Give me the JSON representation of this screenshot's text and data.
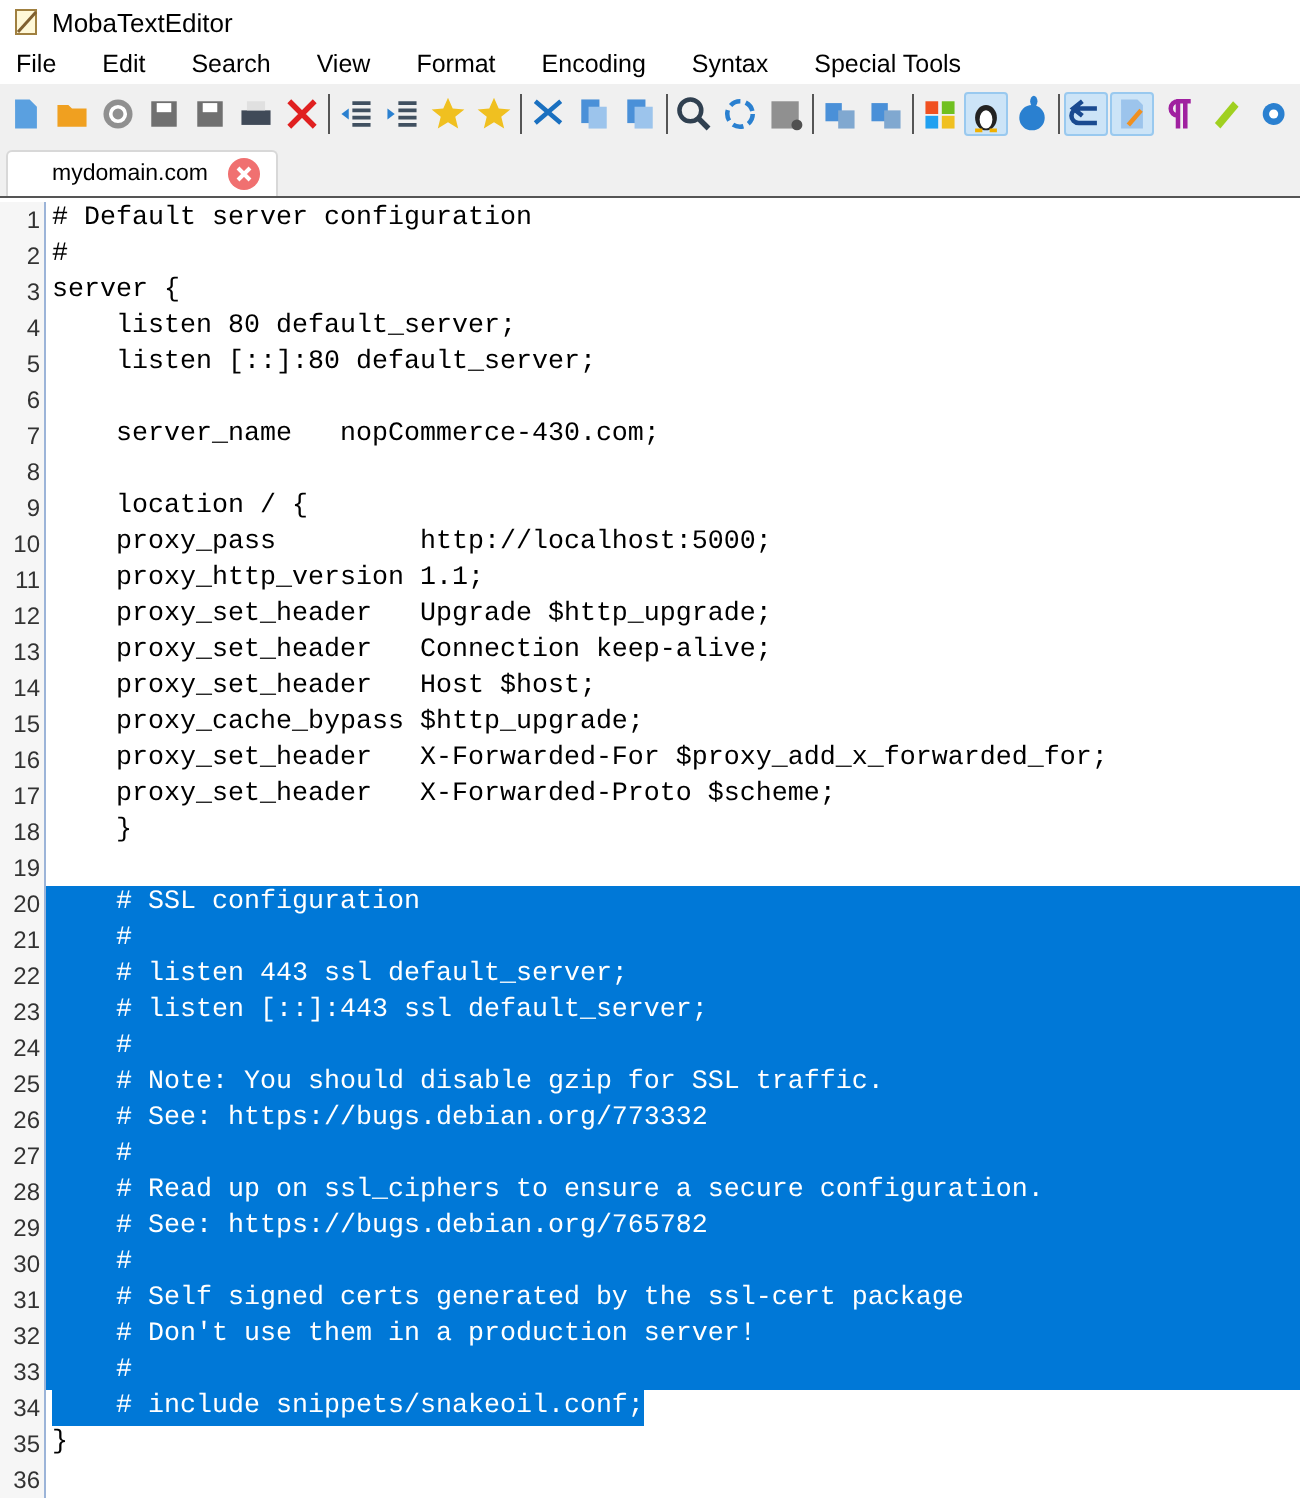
{
  "window": {
    "title": "MobaTextEditor"
  },
  "menu": [
    "File",
    "Edit",
    "Search",
    "View",
    "Format",
    "Encoding",
    "Syntax",
    "Special Tools"
  ],
  "toolbar": [
    {
      "on": false
    },
    {
      "on": false
    },
    {
      "on": false
    },
    {
      "on": false
    },
    {
      "on": false
    },
    {
      "on": false
    },
    {
      "on": false
    },
    {
      "on": false
    },
    {
      "on": false
    },
    {
      "on": false
    },
    {
      "on": false
    },
    {
      "on": false
    },
    {
      "on": false
    },
    {
      "on": false
    },
    {
      "on": false
    },
    {
      "on": false
    },
    {
      "on": false
    },
    {
      "on": false
    },
    {
      "on": false
    },
    {
      "on": false
    },
    {
      "on": true
    },
    {
      "on": false
    },
    {
      "on": true
    },
    {
      "on": true
    },
    {
      "on": false
    },
    {
      "on": false
    },
    {
      "on": false
    }
  ],
  "tabs": [
    {
      "label": "mydomain.com",
      "selected": true
    }
  ],
  "lines": [
    {
      "number": "1",
      "text": "# Default server configuration",
      "selected": false
    },
    {
      "number": "2",
      "text": "#",
      "selected": false
    },
    {
      "number": "3",
      "text": "server {",
      "selected": false
    },
    {
      "number": "4",
      "text": "    listen 80 default_server;",
      "selected": false
    },
    {
      "number": "5",
      "text": "    listen [::]:80 default_server;",
      "selected": false
    },
    {
      "number": "6",
      "selected": false
    },
    {
      "number": "7",
      "text": "    server_name   nopCommerce-430.com;",
      "selected": false
    },
    {
      "number": "8",
      "selected": false
    },
    {
      "number": "9",
      "text": "    location / {",
      "selected": false
    },
    {
      "number": "10",
      "text": "    proxy_pass         http://localhost:5000;",
      "selected": false
    },
    {
      "number": "11",
      "text": "    proxy_http_version 1.1;",
      "selected": false
    },
    {
      "number": "12",
      "text": "    proxy_set_header   Upgrade $http_upgrade;",
      "selected": false
    },
    {
      "number": "13",
      "text": "    proxy_set_header   Connection keep-alive;",
      "selected": false
    },
    {
      "number": "14",
      "text": "    proxy_set_header   Host $host;",
      "selected": false
    },
    {
      "number": "15",
      "text": "    proxy_cache_bypass $http_upgrade;",
      "selected": false
    },
    {
      "number": "16",
      "text": "    proxy_set_header   X-Forwarded-For $proxy_add_x_forwarded_for;",
      "selected": false
    },
    {
      "number": "17",
      "text": "    proxy_set_header   X-Forwarded-Proto $scheme;",
      "selected": false
    },
    {
      "number": "18",
      "text": "    }",
      "selected": false
    },
    {
      "number": "19",
      "selected": false
    },
    {
      "number": "20",
      "text": "    # SSL configuration",
      "selected": true
    },
    {
      "number": "21",
      "text": "    #",
      "selected": true
    },
    {
      "number": "22",
      "text": "    # listen 443 ssl default_server;",
      "selected": true
    },
    {
      "number": "23",
      "text": "    # listen [::]:443 ssl default_server;",
      "selected": true
    },
    {
      "number": "24",
      "text": "    #",
      "selected": true
    },
    {
      "number": "25",
      "text": "    # Note: You should disable gzip for SSL traffic.",
      "selected": true
    },
    {
      "number": "26",
      "text": "    # See: https://bugs.debian.org/773332",
      "selected": true
    },
    {
      "number": "27",
      "text": "    #",
      "selected": true
    },
    {
      "number": "28",
      "text": "    # Read up on ssl_ciphers to ensure a secure configuration.",
      "selected": true
    },
    {
      "number": "29",
      "text": "    # See: https://bugs.debian.org/765782",
      "selected": true
    },
    {
      "number": "30",
      "text": "    #",
      "selected": true
    },
    {
      "number": "31",
      "text": "    # Self signed certs generated by the ssl-cert package",
      "selected": true
    },
    {
      "number": "32",
      "text": "    # Don't use them in a production server!",
      "selected": true
    },
    {
      "number": "33",
      "text": "    #",
      "selected": true
    },
    {
      "number": "34",
      "text": "    # include snippets/snakeoil.conf;",
      "selected": true
    },
    {
      "number": "35",
      "text": "}",
      "selected": false
    },
    {
      "number": "36",
      "selected": false
    }
  ]
}
